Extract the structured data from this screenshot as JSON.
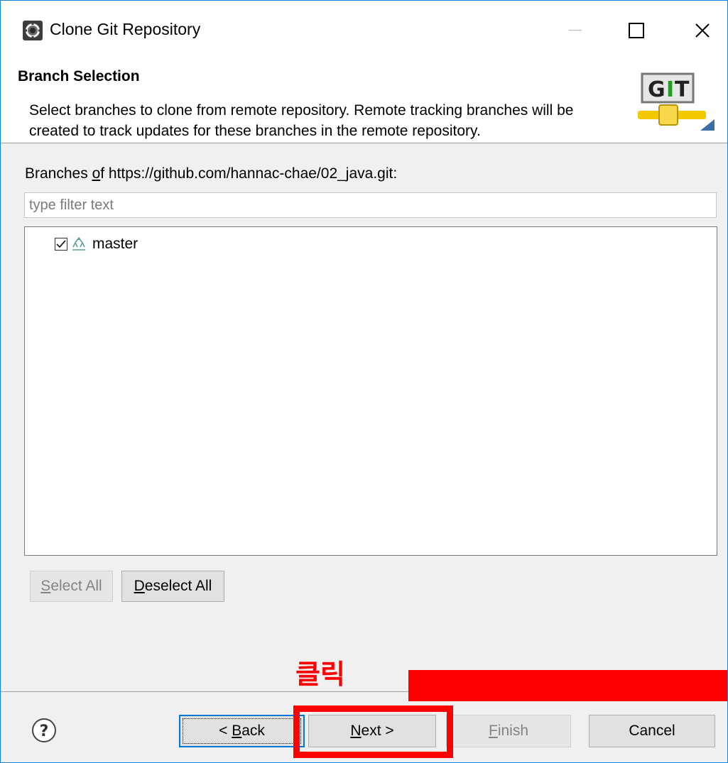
{
  "window": {
    "title": "Clone Git Repository"
  },
  "header": {
    "title": "Branch Selection",
    "description": "Select branches to clone from remote repository. Remote tracking branches will be created to track updates for these branches in the remote repository.",
    "logo_text": "GIT"
  },
  "branches": {
    "label_prefix": "Branches ",
    "label_mnemonic": "o",
    "label_rest": "f https://github.com/hannac-chae/02_java.git:",
    "filter_placeholder": "type filter text",
    "items": [
      {
        "name": "master",
        "checked": true
      }
    ]
  },
  "selection_buttons": {
    "select_all_mnemonic": "S",
    "select_all_rest": "elect All",
    "deselect_all_mnemonic": "D",
    "deselect_all_rest": "eselect All"
  },
  "footer": {
    "back_prefix": "< ",
    "back_mnemonic": "B",
    "back_rest": "ack",
    "next_mnemonic": "N",
    "next_rest": "ext >",
    "finish_mnemonic": "F",
    "finish_rest": "inish",
    "cancel_label": "Cancel"
  },
  "annotation": {
    "text": "클릭",
    "color": "#ff0000"
  },
  "colors": {
    "window_border": "#1883d7",
    "focus_border": "#0078d7",
    "background": "#f0f0f0"
  }
}
